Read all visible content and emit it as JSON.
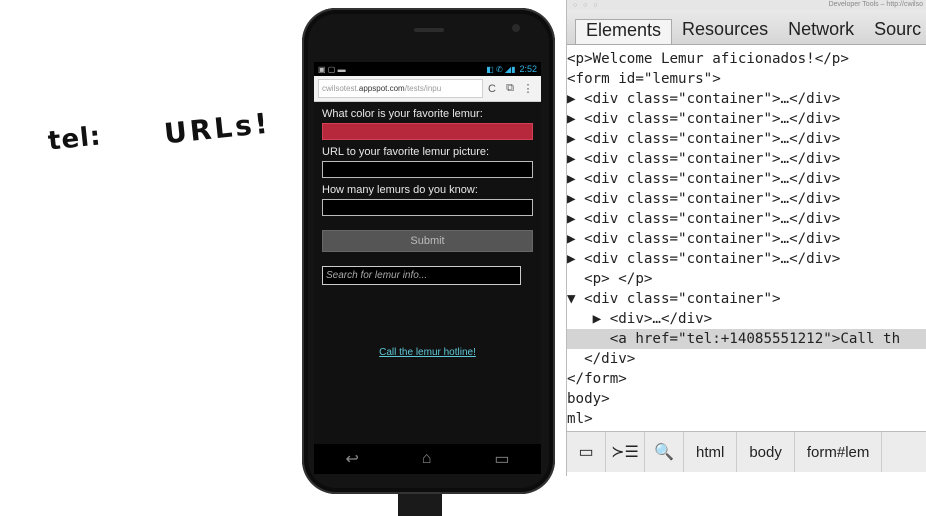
{
  "note": {
    "tel": "tel:",
    "urls": "URLs!"
  },
  "phone": {
    "status": {
      "left_icons": "▣ ▢ ▬",
      "right_icons": "◧ ✆ ◢▮",
      "time": "2:52"
    },
    "url": {
      "host_prefix": "cwilsotest.",
      "host": "appspot.com",
      "path": "/tests/inpu"
    },
    "form": {
      "color_label": "What color is your favorite lemur:",
      "url_label": "URL to your favorite lemur picture:",
      "count_label": "How many lemurs do you know:",
      "submit_label": "Submit",
      "search_placeholder": "Search for lemur info...",
      "hotline_link": "Call the lemur hotline!"
    },
    "nav": {
      "back": "↩",
      "home": "⌂",
      "recent": "▭"
    }
  },
  "devtools": {
    "titlebar": "Developer Tools – http://cwilso",
    "traffic": "○ ○ ○",
    "tabs": [
      "Elements",
      "Resources",
      "Network",
      "Sourc"
    ],
    "lines": [
      {
        "text": "<p>Welcome Lemur aficionados!</p>"
      },
      {
        "text": "<form id=\"lemurs\">"
      },
      {
        "text": "▶ <div class=\"container\">…</div>"
      },
      {
        "text": "▶ <div class=\"container\">…</div>"
      },
      {
        "text": "▶ <div class=\"container\">…</div>"
      },
      {
        "text": "▶ <div class=\"container\">…</div>"
      },
      {
        "text": "▶ <div class=\"container\">…</div>"
      },
      {
        "text": "▶ <div class=\"container\">…</div>"
      },
      {
        "text": "▶ <div class=\"container\">…</div>"
      },
      {
        "text": "▶ <div class=\"container\">…</div>"
      },
      {
        "text": "▶ <div class=\"container\">…</div>"
      },
      {
        "text": "  <p> </p>"
      },
      {
        "text": "▼ <div class=\"container\">"
      },
      {
        "text": "   ▶ <div>…</div>"
      },
      {
        "text": "     <a href=\"tel:+14085551212\">Call th"
      },
      {
        "text": "  </div>"
      },
      {
        "text": "</form>"
      },
      {
        "text": "body>"
      },
      {
        "text": "ml>"
      }
    ],
    "bottom": {
      "dock_icon": "▭",
      "console_icon": "≻☰",
      "search_icon": "🔍",
      "crumbs": [
        "html",
        "body",
        "form#lem"
      ]
    }
  }
}
